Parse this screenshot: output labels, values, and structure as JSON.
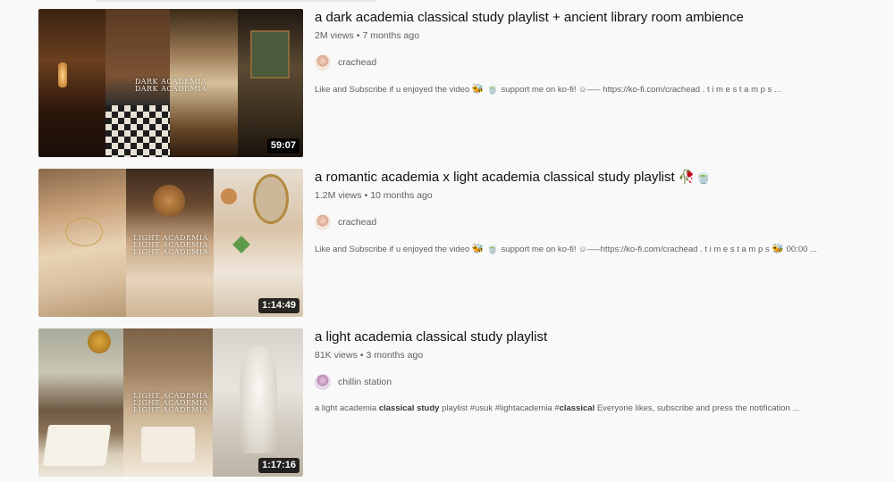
{
  "videos": [
    {
      "title": "a dark academia classical study playlist + ancient library room ambience",
      "views": "2M views",
      "age": "7 months ago",
      "channel": "crachead",
      "duration": "59:07",
      "thumb_text": [
        "DARK ACADEMIA",
        "DARK ACADEMIA"
      ],
      "desc_parts": [
        "Like and Subscribe if u enjoyed the video ",
        "🐝",
        " ",
        "🍵",
        " support me on ko-fi! ",
        "☺",
        "—– https://ko-fi.com/crachead . t i m e s t a m p s ..."
      ]
    },
    {
      "title": "a romantic academia x light academia classical study playlist ",
      "title_emoji": "🥀🍵",
      "views": "1.2M views",
      "age": "10 months ago",
      "channel": "crachead",
      "duration": "1:14:49",
      "thumb_text": [
        "LIGHT ACADEMIA",
        "LIGHT ACADEMIA",
        "LIGHT ACADEMIA"
      ],
      "desc_parts": [
        "Like and Subscribe if u enjoyed the video ",
        "🐝",
        " ",
        "🍵",
        " support me on ko-fi! ",
        "☺",
        "—–https://ko-fi.com/crachead . t i m e s t a m p s ",
        "🐝",
        " 00:00 ..."
      ]
    },
    {
      "title": "a light academia classical study playlist",
      "views": "81K views",
      "age": "3 months ago",
      "channel": "chillin station",
      "duration": "1:17:16",
      "thumb_text": [
        "LIGHT ACADEMIA",
        "LIGHT ACADEMIA",
        "LIGHT ACADEMIA"
      ],
      "desc_parts": [
        "a light academia ",
        "classical study",
        " playlist #usuk #lightacademia #",
        "classical",
        " Everyone likes, subscribe and press the notification ..."
      ]
    }
  ],
  "separator": "•",
  "colors": {
    "bg": "#f9f9f9",
    "title": "#0f0f0f",
    "meta": "#606060",
    "duration_bg": "#000000"
  }
}
